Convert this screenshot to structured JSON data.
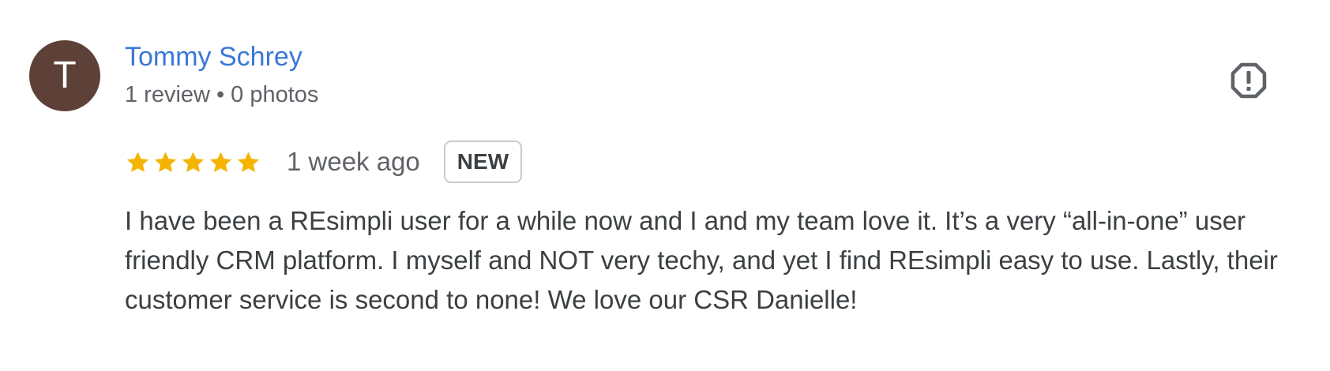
{
  "review": {
    "author": {
      "initial": "T",
      "name": "Tommy Schrey",
      "review_count": "1 review",
      "separator": "•",
      "photo_count": "0 photos",
      "avatar_color": "#5d4037"
    },
    "rating": 5,
    "rating_max": 5,
    "star_color": "#f4b400",
    "time_ago": "1 week ago",
    "badge": "NEW",
    "text": "I have been a REsimpli user for a while now and I and my team love it. It’s a very “all-in-one” user friendly CRM platform. I myself and NOT very techy, and yet I find REsimpli easy to use. Lastly, their customer service is second to none! We love our CSR Danielle!",
    "report_icon": "report-flag-icon"
  }
}
